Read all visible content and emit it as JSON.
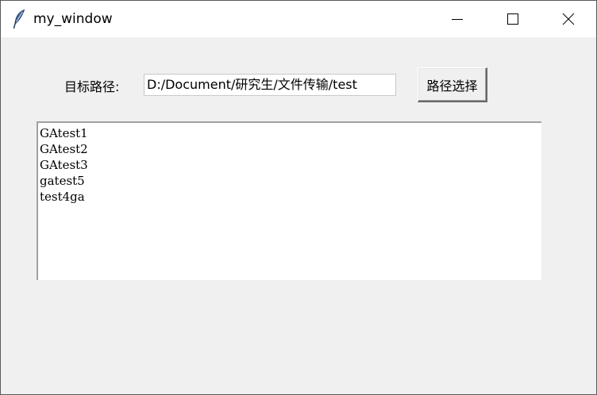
{
  "window": {
    "title": "my_window",
    "controls": {
      "minimize": "minimize-icon",
      "maximize": "maximize-icon",
      "close": "close-icon"
    }
  },
  "form": {
    "path_label": "目标路径:",
    "path_value": "D:/Document/研究生/文件传输/test",
    "select_button_label": "路径选择"
  },
  "listbox": {
    "items": [
      "GAtest1",
      "GAtest2",
      "GAtest3",
      "gatest5",
      "test4ga"
    ]
  },
  "colors": {
    "window_background": "#f0f0f0",
    "titlebar_background": "#ffffff",
    "field_background": "#ffffff"
  }
}
